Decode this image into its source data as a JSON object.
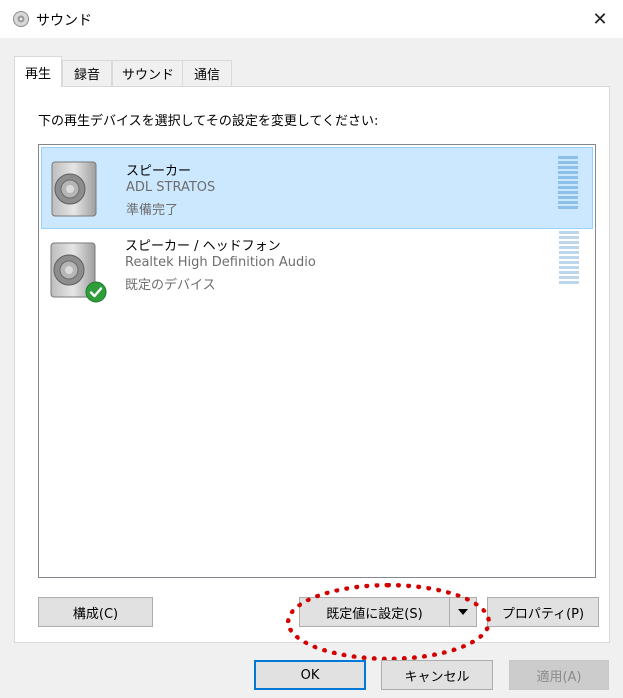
{
  "window": {
    "title": "サウンド",
    "close_glyph": "✕"
  },
  "tabs": [
    {
      "label": "再生",
      "active": true
    },
    {
      "label": "録音",
      "active": false
    },
    {
      "label": "サウンド",
      "active": false
    },
    {
      "label": "通信",
      "active": false
    }
  ],
  "instruction": "下の再生デバイスを選択してその設定を変更してください:",
  "devices": [
    {
      "name": "スピーカー",
      "driver": "ADL STRATOS",
      "status": "準備完了",
      "selected": true,
      "default": false
    },
    {
      "name": "スピーカー / ヘッドフォン",
      "driver": "Realtek High Definition Audio",
      "status": "既定のデバイス",
      "selected": false,
      "default": true
    }
  ],
  "buttons": {
    "configure": "構成(C)",
    "set_default": "既定値に設定(S)",
    "properties": "プロパティ(P)",
    "ok": "OK",
    "cancel": "キャンセル",
    "apply": "適用(A)"
  },
  "colors": {
    "selection": "#cce8ff",
    "annotation": "#d30000",
    "accent": "#0078d7"
  }
}
